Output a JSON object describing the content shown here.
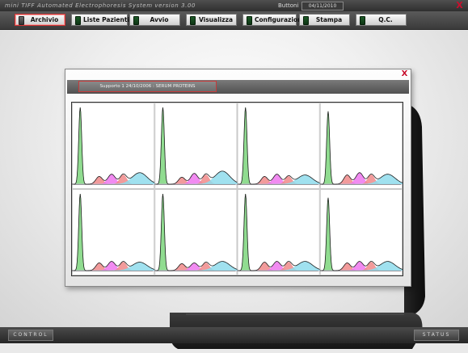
{
  "window": {
    "title": "mini TIFF   Automated Electrophoresis System  version 3.00",
    "mode_label": "Buttoni",
    "date": "04/11/2010",
    "close_glyph": "X"
  },
  "menu": {
    "items": [
      {
        "label": "Archivio",
        "active": true
      },
      {
        "label": "Liste Pazienti",
        "active": false
      },
      {
        "label": "Avvio",
        "active": false
      },
      {
        "label": "Visualizza",
        "active": false
      },
      {
        "label": "Configurazioni",
        "active": false
      },
      {
        "label": "Stampa",
        "active": false
      },
      {
        "label": "Q.C.",
        "active": false
      }
    ]
  },
  "dialog": {
    "close_glyph": "X",
    "tab_label": "Supporto 1 24/10/2006 : SERUM PROTEINS"
  },
  "chart_data": {
    "type": "area",
    "title": "",
    "grid": "2 rows x 4 columns",
    "series_colors": {
      "albumin": "#7cd67c",
      "alpha1": "#f08a8a",
      "alpha2": "#ee77ee",
      "beta": "#f08a8a",
      "gamma": "#8fdcec",
      "curve": "#202020"
    },
    "panels": [
      {
        "albumin": 1.0,
        "alpha1": 0.1,
        "alpha2": 0.13,
        "beta": 0.12,
        "gamma": 0.15
      },
      {
        "albumin": 1.0,
        "alpha1": 0.09,
        "alpha2": 0.14,
        "beta": 0.12,
        "gamma": 0.17
      },
      {
        "albumin": 1.0,
        "alpha1": 0.1,
        "alpha2": 0.13,
        "beta": 0.1,
        "gamma": 0.12
      },
      {
        "albumin": 0.95,
        "alpha1": 0.12,
        "alpha2": 0.15,
        "beta": 0.12,
        "gamma": 0.13
      },
      {
        "albumin": 1.0,
        "alpha1": 0.1,
        "alpha2": 0.12,
        "beta": 0.11,
        "gamma": 0.11
      },
      {
        "albumin": 1.0,
        "alpha1": 0.09,
        "alpha2": 0.1,
        "beta": 0.1,
        "gamma": 0.12
      },
      {
        "albumin": 1.0,
        "alpha1": 0.11,
        "alpha2": 0.12,
        "beta": 0.11,
        "gamma": 0.12
      },
      {
        "albumin": 0.95,
        "alpha1": 0.1,
        "alpha2": 0.12,
        "beta": 0.11,
        "gamma": 0.12
      }
    ]
  },
  "status": {
    "left_button": "CONTROL",
    "right_button": "STATUS"
  }
}
